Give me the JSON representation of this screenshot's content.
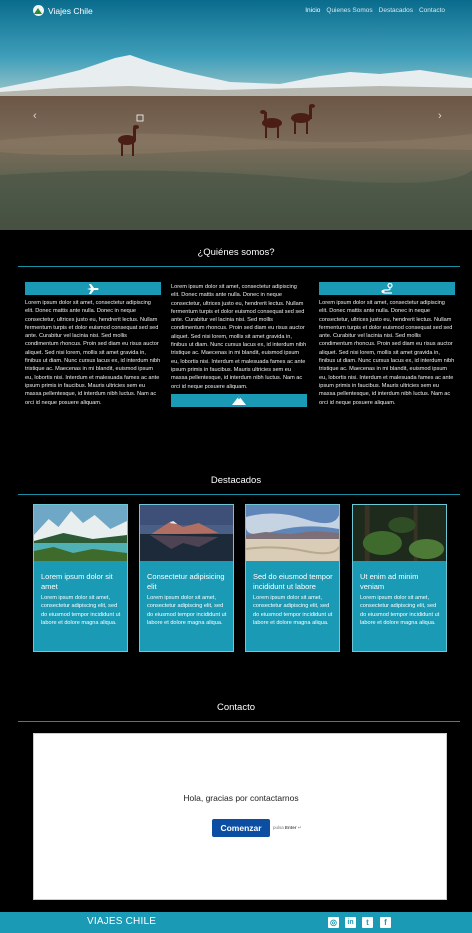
{
  "header": {
    "brand": "Viajes Chile",
    "menu": [
      "Inicio",
      "Quienes Somos",
      "Destacados",
      "Contacto"
    ],
    "active_index": 0,
    "prev_arrow": "‹",
    "next_arrow": "›"
  },
  "about": {
    "title": "¿Quiénes somos?",
    "columns": [
      {
        "icon": "plane-icon",
        "text": "Lorem ipsum dolor sit amet, consectetur adipiscing elit. Donec mattis ante nulla. Donec in neque consectetur, ultrices justo eu, hendrerit lectus. Nullam fermentum turpis et dolor euismod consequat sed sed ante. Curabitur vel lacinia nisi. Sed mollis condimentum rhoncus. Proin sed diam eu risus auctor aliquet. Sed nisi lorem, mollis sit amet gravida in, finibus ut diam. Nunc cursus lacus ex, id interdum nibh tristique ac. Maecenas in mi blandit, euismod ipsum eu, lobortis nisi. Interdum et malesuada fames ac ante ipsum primis in faucibus. Mauris ultricies sem eu massa pellentesque, id interdum nibh luctus. Nam ac orci id neque posuere aliquam."
      },
      {
        "icon": "mountain-icon",
        "text": "Lorem ipsum dolor sit amet, consectetur adipiscing elit. Donec mattis ante nulla. Donec in neque consectetur, ultrices justo eu, hendrerit lectus. Nullam fermentum turpis et dolor euismod consequat sed sed ante. Curabitur vel lacinia nisi. Sed mollis condimentum rhoncus. Proin sed diam eu risus auctor aliquet. Sed nisi lorem, mollis sit amet gravida in, finibus ut diam. Nunc cursus lacus ex, id interdum nibh tristique ac. Maecenas in mi blandit, euismod ipsum eu, lobortis nisi. Interdum et malesuada fames ac ante ipsum primis in faucibus. Mauris ultricies sem eu massa pellentesque, id interdum nibh luctus. Nam ac orci id neque posuere aliquam."
      },
      {
        "icon": "route-icon",
        "text": "Lorem ipsum dolor sit amet, consectetur adipiscing elit. Donec mattis ante nulla. Donec in neque consectetur, ultrices justo eu, hendrerit lectus. Nullam fermentum turpis et dolor euismod consequat sed sed ante. Curabitur vel lacinia nisi. Sed mollis condimentum rhoncus. Proin sed diam eu risus auctor aliquet. Sed nisi lorem, mollis sit amet gravida in, finibus ut diam. Nunc cursus lacus ex, id interdum nibh tristique ac. Maecenas in mi blandit, euismod ipsum eu, lobortis nisi. Interdum et malesuada fames ac ante ipsum primis in faucibus. Mauris ultricies sem eu massa pellentesque, id interdum nibh luctus. Nam ac orci id neque posuere aliquam."
      }
    ]
  },
  "featured": {
    "title": "Destacados",
    "cards": [
      {
        "title": "Lorem ipsum dolor sit amet",
        "text": "Lorem ipsum dolor sit amet, consectetur adipiscing elit, sed do eiusmod tempor incididunt ut labore et dolore magna aliqua."
      },
      {
        "title": "Consectetur adipisicing elit",
        "text": "Lorem ipsum dolor sit amet, consectetur adipiscing elit, sed do eiusmod tempor incididunt ut labore et dolore magna aliqua."
      },
      {
        "title": "Sed do eiusmod tempor incididunt ut labore",
        "text": "Lorem ipsum dolor sit amet, consectetur adipiscing elit, sed do eiusmod tempor incididunt ut labore et dolore magna aliqua."
      },
      {
        "title": "Ut enim ad minim veniam",
        "text": "Lorem ipsum dolor sit amet, consectetur adipiscing elit, sed do eiusmod tempor incididunt ut labore et dolore magna aliqua."
      }
    ]
  },
  "contact": {
    "title": "Contacto",
    "message": "Hola, gracias por contactarnos",
    "button": "Comenzar",
    "hint_prefix": "pulsa",
    "hint_key": "Enter",
    "hint_suffix": "↵"
  },
  "footer": {
    "brand": "VIAJES CHILE",
    "social": [
      "instagram-icon",
      "linkedin-icon",
      "twitter-icon",
      "facebook-icon"
    ],
    "social_glyphs": [
      "◎",
      "in",
      "t",
      "f"
    ]
  },
  "colors": {
    "accent": "#1a9ab4",
    "button": "#0b4ea2",
    "background": "#000000"
  }
}
